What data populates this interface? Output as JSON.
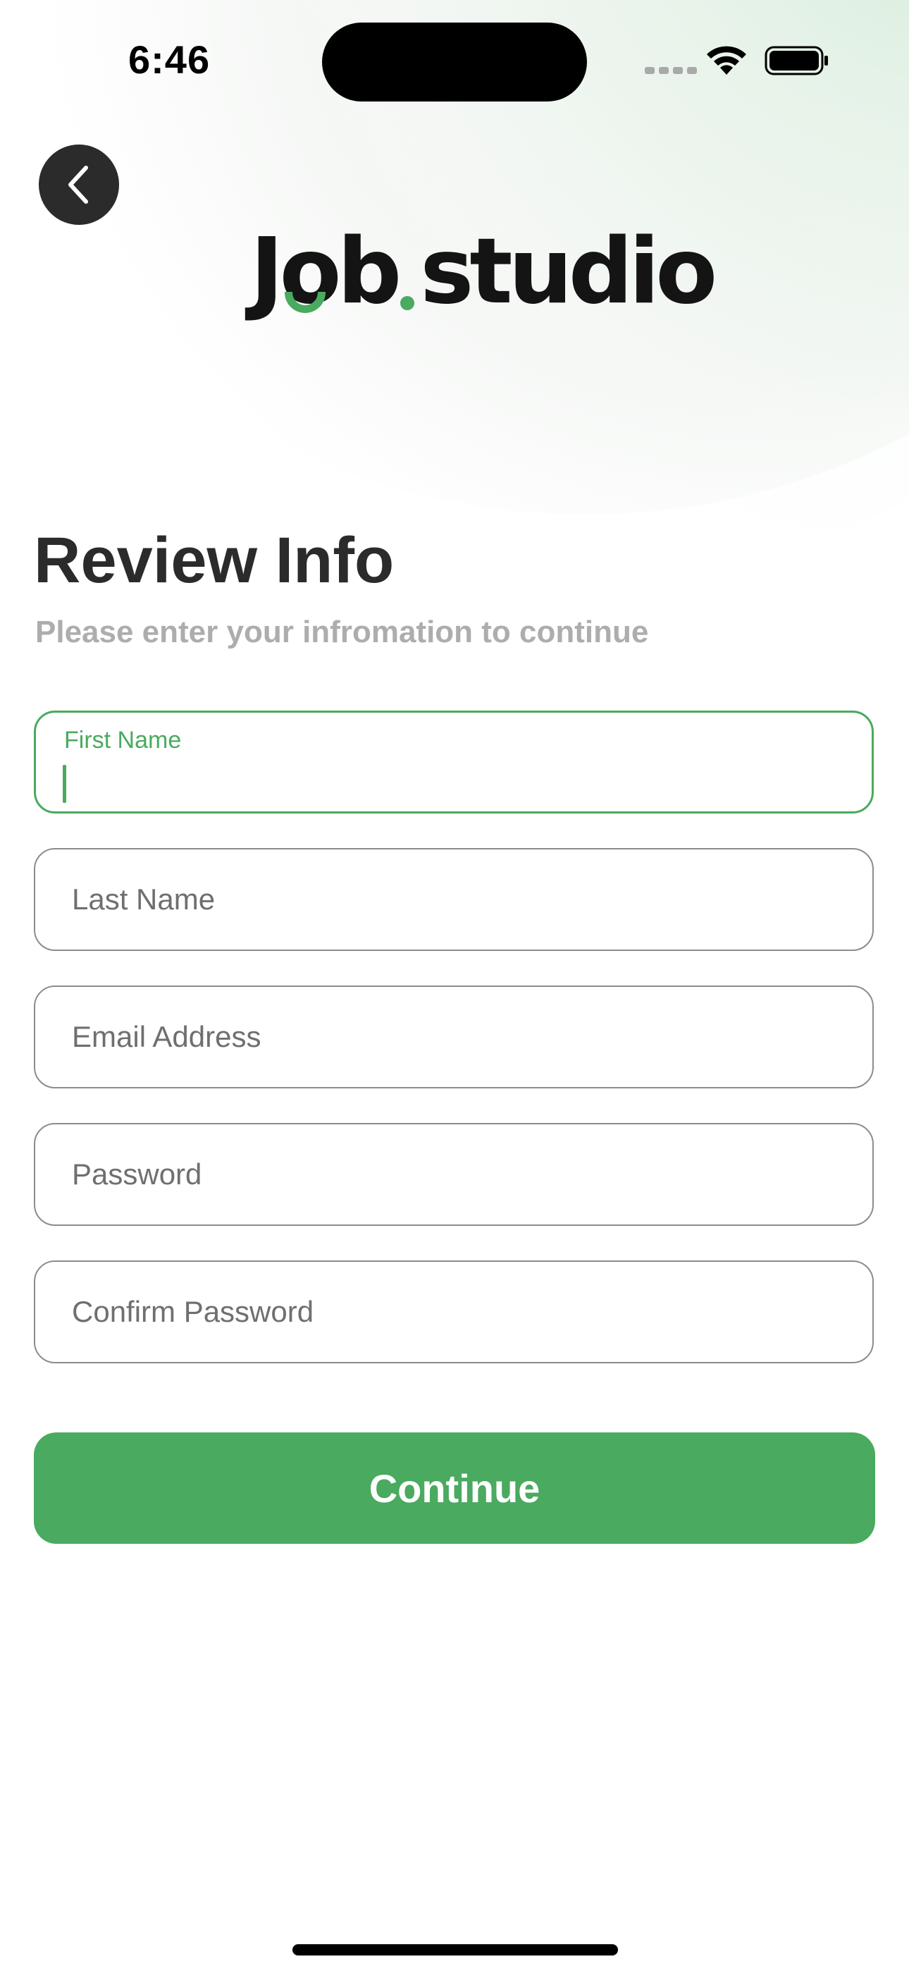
{
  "status_bar": {
    "time": "6:46"
  },
  "header": {
    "back_icon": "chevron-left-icon",
    "logo_text_part1": "J",
    "logo_text_o": "o",
    "logo_text_part2": "b",
    "logo_text_part3": "studio"
  },
  "main": {
    "title": "Review Info",
    "subtitle": "Please enter your infromation to continue"
  },
  "form": {
    "first_name": {
      "label": "First Name",
      "value": ""
    },
    "last_name": {
      "placeholder": "Last Name"
    },
    "email": {
      "placeholder": "Email Address"
    },
    "password": {
      "placeholder": "Password"
    },
    "confirm_password": {
      "placeholder": "Confirm Password"
    },
    "continue_label": "Continue"
  },
  "colors": {
    "accent": "#4aaa5f",
    "title": "#2b2b2b",
    "subtitle": "#adadad",
    "back_button_bg": "#2b2b2b"
  }
}
